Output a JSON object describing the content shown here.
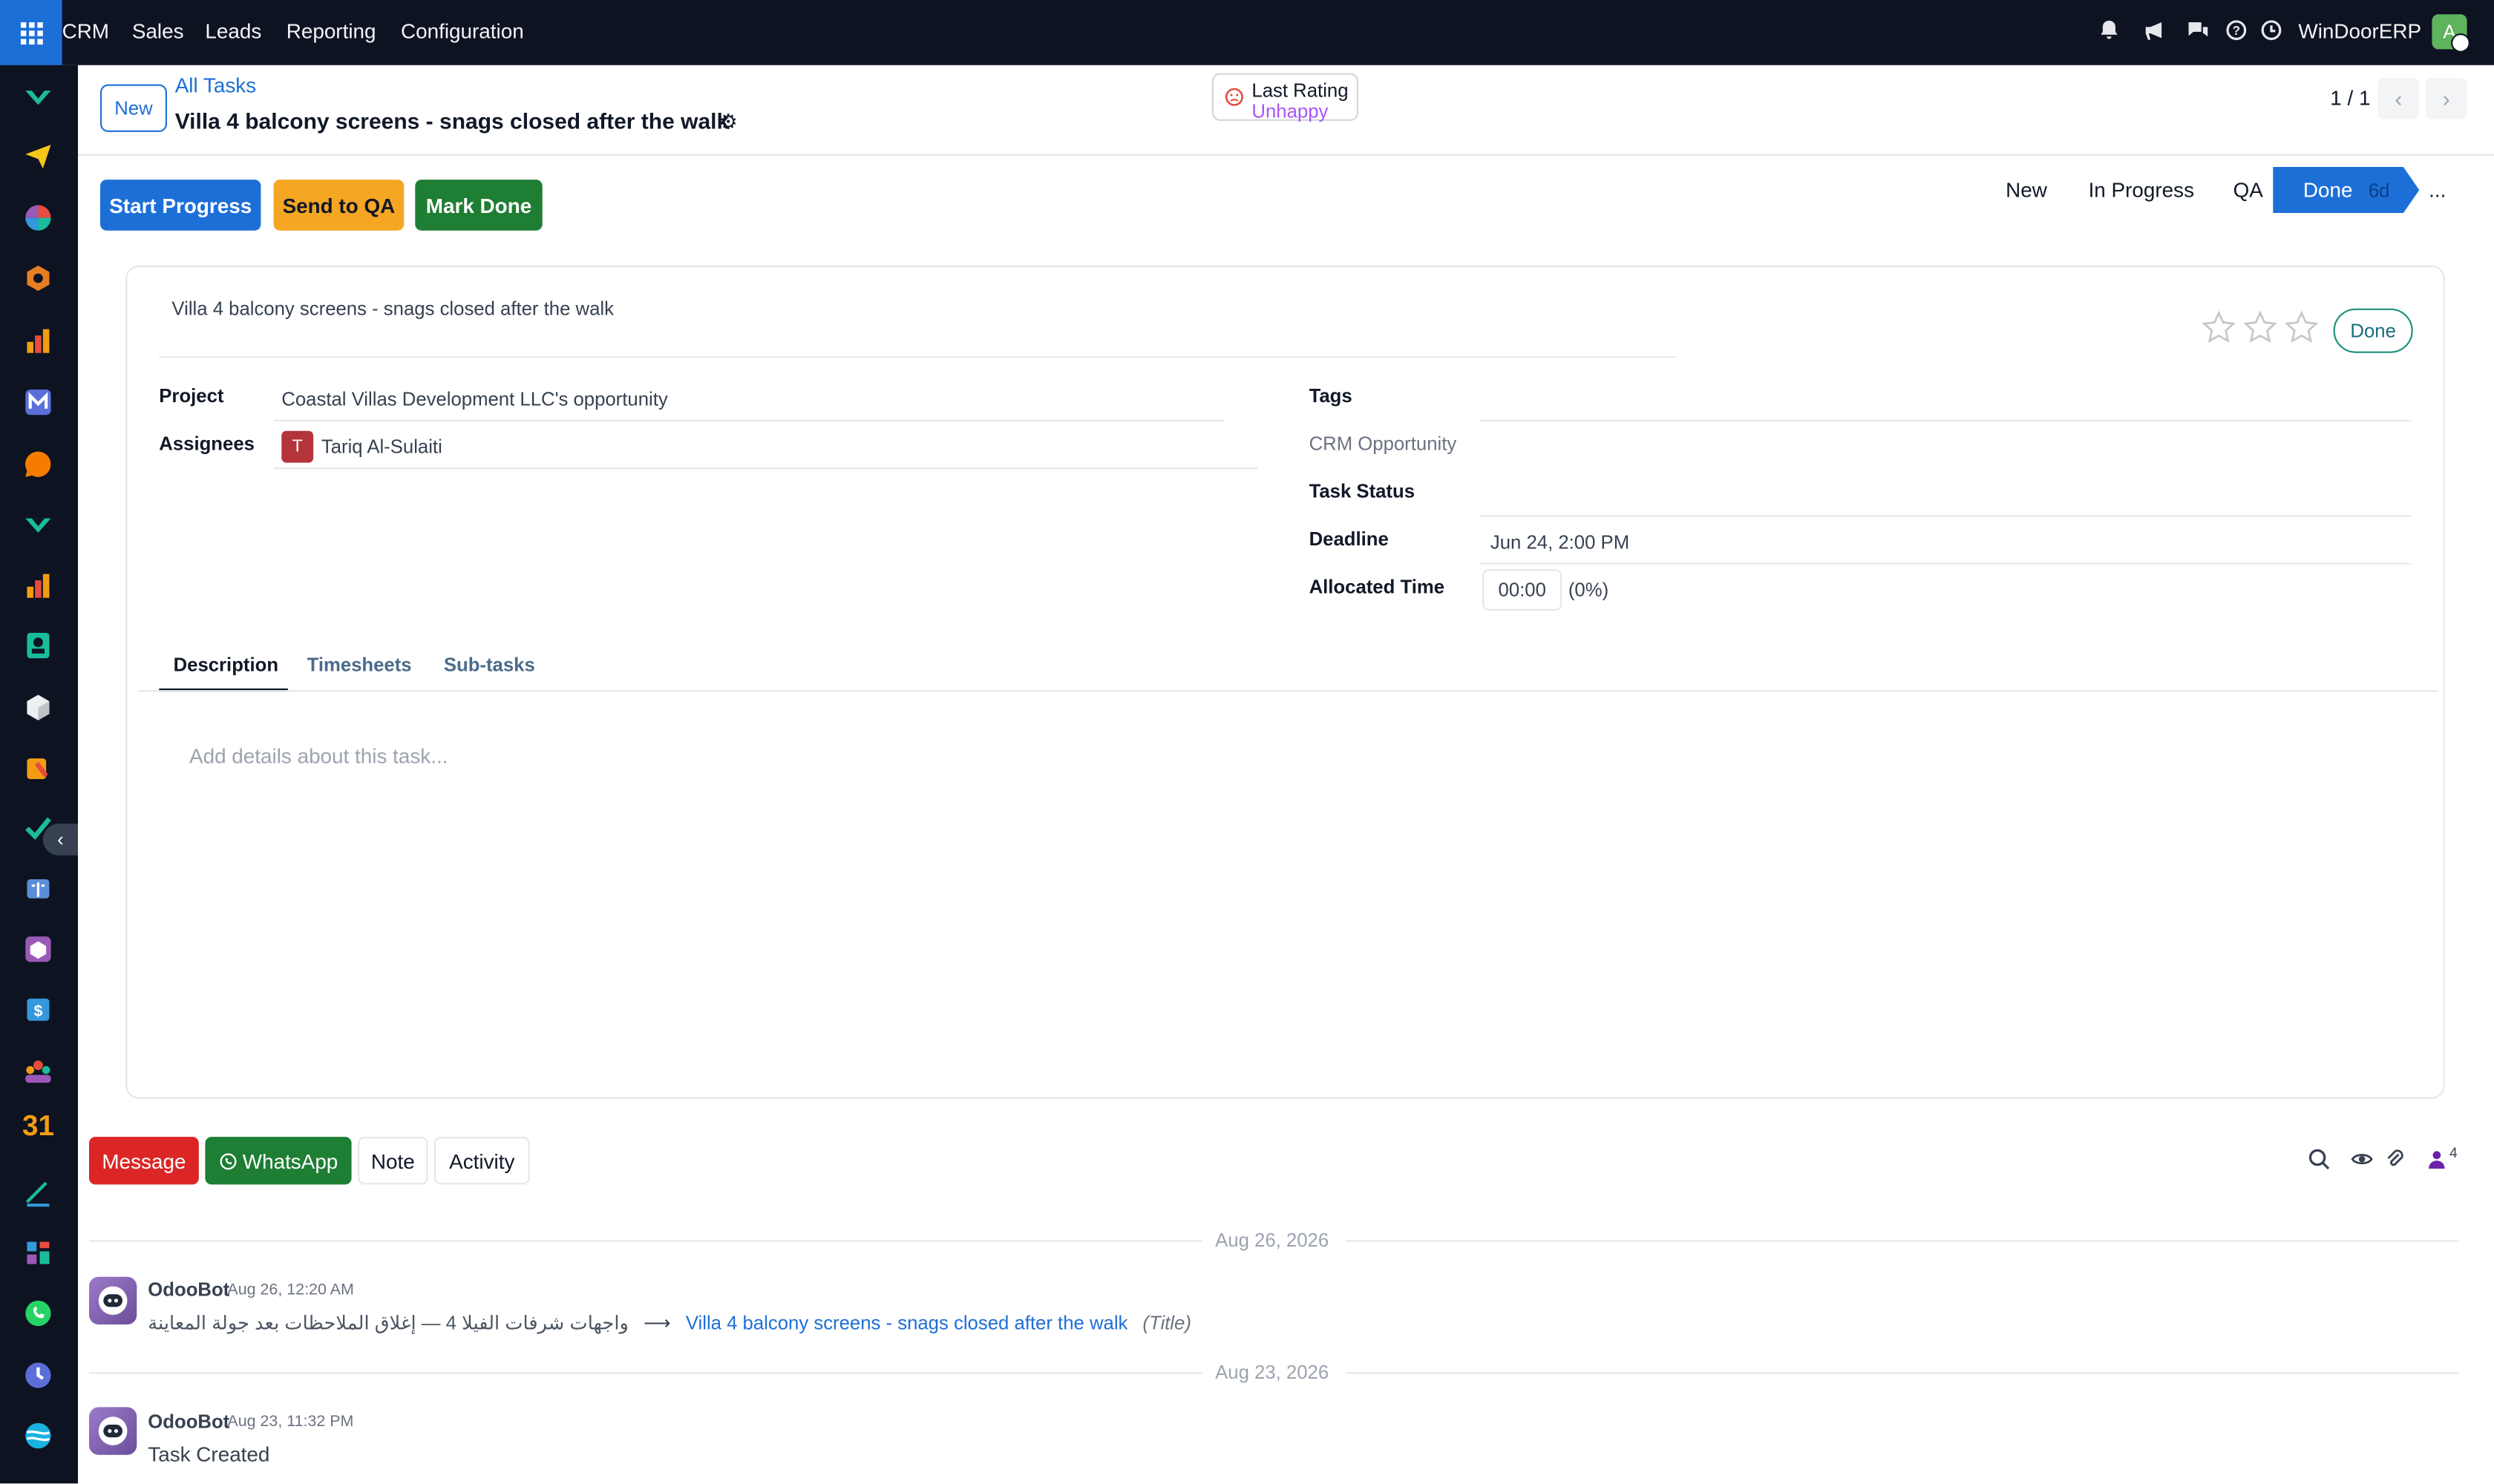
{
  "topbar": {
    "menu": [
      "CRM",
      "Sales",
      "Leads",
      "Reporting",
      "Configuration"
    ],
    "company": "WinDoorERP",
    "user_initial": "A",
    "icons": [
      "bell-icon",
      "megaphone-icon",
      "chat-icon",
      "help-icon",
      "clock-icon"
    ]
  },
  "sidebar": {
    "apps": [
      "discuss-app-icon",
      "send-app-icon",
      "dashboard-app-icon",
      "inventory-app-icon",
      "reports-app-icon",
      "mail-app-icon",
      "livechat-app-icon",
      "projects-app-icon",
      "analytics-app-icon",
      "contacts-app-icon",
      "product-app-icon",
      "documents-app-icon",
      "tasks-app-icon",
      "knowledge-app-icon",
      "package-app-icon",
      "invoicing-app-icon",
      "team-app-icon",
      "calendar-app-icon",
      "sign-app-icon",
      "dashboards-app-icon",
      "whatsapp-app-icon",
      "timesheet-app-icon",
      "website-app-icon"
    ],
    "calendar_label": "31"
  },
  "control": {
    "new_label": "New",
    "breadcrumb": "All Tasks",
    "title": "Villa 4 balcony screens - snags closed after the walk",
    "rating_label": "Last Rating",
    "rating_value": "Unhappy",
    "pager": "1 / 1"
  },
  "actions": {
    "start_progress": "Start Progress",
    "send_qa": "Send to QA",
    "mark_done": "Mark Done"
  },
  "statusbar": {
    "stages": [
      "New",
      "In Progress",
      "QA"
    ],
    "current": "Done",
    "current_days": "6d",
    "more": "..."
  },
  "form": {
    "name": "Villa 4 balcony screens - snags closed after the walk",
    "state_label": "Done",
    "stars": 0,
    "project_label": "Project",
    "project_value": "Coastal Villas Development LLC's opportunity",
    "assignees_label": "Assignees",
    "assignee_initial": "T",
    "assignee_name": "Tariq Al-Sulaiti",
    "tags_label": "Tags",
    "crm_label": "CRM Opportunity",
    "task_status_label": "Task Status",
    "deadline_label": "Deadline",
    "deadline_value": "Jun 24, 2:00 PM",
    "allocated_label": "Allocated Time",
    "allocated_value": "00:00",
    "allocated_pct": "(0%)",
    "tabs": [
      "Description",
      "Timesheets",
      "Sub-tasks"
    ],
    "description_placeholder": "Add details about this task..."
  },
  "chatter": {
    "message_btn": "Message",
    "whatsapp_btn": "WhatsApp",
    "note_btn": "Note",
    "activity_btn": "Activity",
    "followers_count": "4",
    "messages": [
      {
        "date_sep": "Aug 26, 2026",
        "author": "OdooBot",
        "date": "Aug 26, 12:20 AM",
        "old_value": "واجهات شرفات الفيلا 4 — إغلاق الملاحظات بعد جولة المعاينة",
        "arrow": "⟶",
        "new_value": "Villa 4 balcony screens - snags closed after the walk",
        "field": "(Title)"
      },
      {
        "date_sep": "Aug 23, 2026",
        "author": "OdooBot",
        "date": "Aug 23, 11:32 PM",
        "body": "Task Created"
      }
    ]
  },
  "colors": {
    "primary": "#1d6fd8",
    "warning": "#f5a623",
    "success": "#1e7e34",
    "danger": "#dc2626",
    "dark_bar": "#0d1321",
    "rating_unhappy": "#a855f7"
  }
}
